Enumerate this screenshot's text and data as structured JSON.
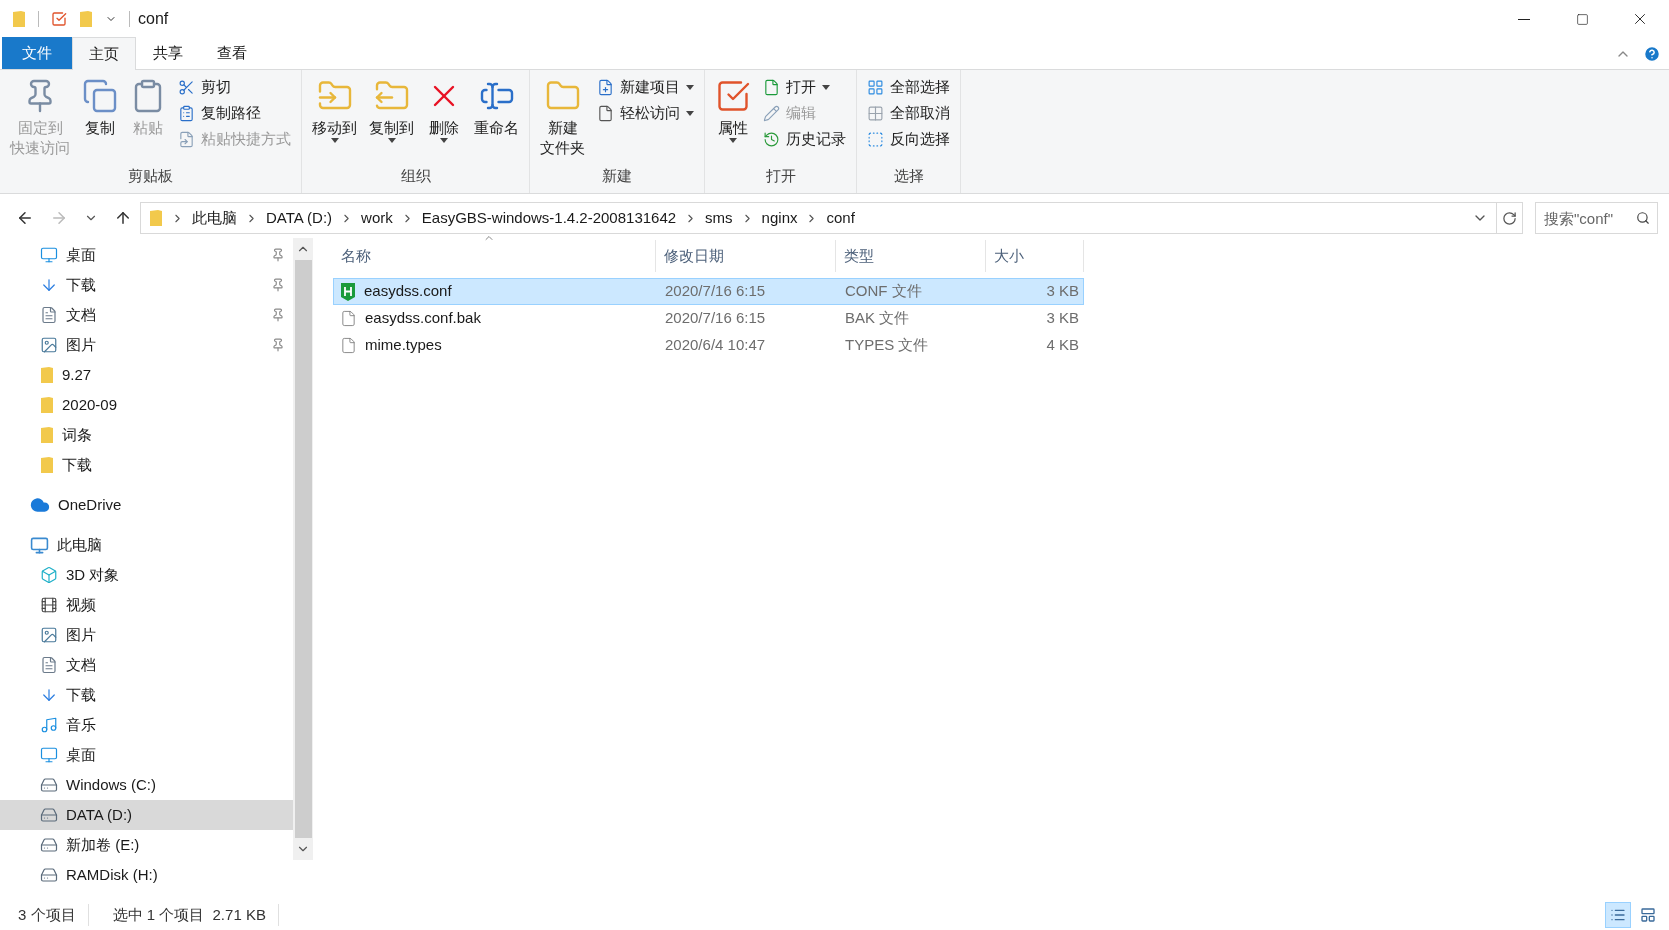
{
  "window": {
    "title": "conf"
  },
  "ribbon": {
    "tabs": [
      {
        "label": "文件",
        "kind": "file",
        "selected": false
      },
      {
        "label": "主页",
        "kind": "tab",
        "selected": true
      },
      {
        "label": "共享",
        "kind": "tab",
        "selected": false
      },
      {
        "label": "查看",
        "kind": "tab",
        "selected": false
      }
    ],
    "groups": [
      {
        "label": "剪贴板",
        "items": [
          {
            "lines": [
              "固定到",
              "快速访问"
            ],
            "kind": "large",
            "disabled": true,
            "caret": false
          },
          {
            "lines": [
              "复制"
            ],
            "kind": "large",
            "disabled": false,
            "caret": false
          },
          {
            "lines": [
              "粘贴"
            ],
            "kind": "large",
            "disabled": true,
            "caret": false
          },
          {
            "label": "剪切",
            "kind": "small",
            "disabled": false,
            "caret": false
          },
          {
            "label": "复制路径",
            "kind": "small",
            "disabled": false,
            "caret": false
          },
          {
            "label": "粘贴快捷方式",
            "kind": "small",
            "disabled": true,
            "caret": false
          }
        ]
      },
      {
        "label": "组织",
        "items": [
          {
            "lines": [
              "移动到"
            ],
            "kind": "large",
            "disabled": false,
            "caret": true
          },
          {
            "lines": [
              "复制到"
            ],
            "kind": "large",
            "disabled": false,
            "caret": true
          },
          {
            "lines": [
              "删除"
            ],
            "kind": "large",
            "disabled": false,
            "caret": true
          },
          {
            "lines": [
              "重命名"
            ],
            "kind": "large",
            "disabled": false,
            "caret": false
          }
        ]
      },
      {
        "label": "新建",
        "items": [
          {
            "lines": [
              "新建",
              "文件夹"
            ],
            "kind": "large",
            "disabled": false,
            "caret": false
          },
          {
            "label": "新建项目",
            "kind": "small",
            "disabled": false,
            "caret": true
          },
          {
            "label": "轻松访问",
            "kind": "small",
            "disabled": false,
            "caret": true
          }
        ]
      },
      {
        "label": "打开",
        "items": [
          {
            "lines": [
              "属性"
            ],
            "kind": "large",
            "disabled": false,
            "caret": true
          },
          {
            "label": "打开",
            "kind": "small",
            "disabled": false,
            "caret": true
          },
          {
            "label": "编辑",
            "kind": "small",
            "disabled": true,
            "caret": false
          },
          {
            "label": "历史记录",
            "kind": "small",
            "disabled": false,
            "caret": false
          }
        ]
      },
      {
        "label": "选择",
        "items": [
          {
            "label": "全部选择",
            "kind": "small",
            "disabled": false,
            "caret": false
          },
          {
            "label": "全部取消",
            "kind": "small",
            "disabled": false,
            "caret": false
          },
          {
            "label": "反向选择",
            "kind": "small",
            "disabled": false,
            "caret": false
          }
        ]
      }
    ]
  },
  "address": {
    "path": [
      "此电脑",
      "DATA (D:)",
      "work",
      "EasyGBS-windows-1.4.2-2008131642",
      "sms",
      "nginx",
      "conf"
    ],
    "search_placeholder": "搜索\"conf\""
  },
  "nav": {
    "quick_access": [
      {
        "label": "桌面",
        "pinned": true
      },
      {
        "label": "下载",
        "pinned": true
      },
      {
        "label": "文档",
        "pinned": true
      },
      {
        "label": "图片",
        "pinned": true
      },
      {
        "label": "9.27",
        "pinned": false
      },
      {
        "label": "2020-09",
        "pinned": false
      },
      {
        "label": "词条",
        "pinned": false
      },
      {
        "label": "下载",
        "pinned": false
      }
    ],
    "onedrive": {
      "label": "OneDrive"
    },
    "this_pc": {
      "label": "此电脑",
      "children": [
        {
          "label": "3D 对象",
          "selected": false
        },
        {
          "label": "视频",
          "selected": false
        },
        {
          "label": "图片",
          "selected": false
        },
        {
          "label": "文档",
          "selected": false
        },
        {
          "label": "下载",
          "selected": false
        },
        {
          "label": "音乐",
          "selected": false
        },
        {
          "label": "桌面",
          "selected": false
        },
        {
          "label": "Windows (C:)",
          "selected": false
        },
        {
          "label": "DATA (D:)",
          "selected": true
        },
        {
          "label": "新加卷 (E:)",
          "selected": false
        },
        {
          "label": "RAMDisk (H:)",
          "selected": false
        }
      ]
    }
  },
  "files": {
    "columns": [
      "名称",
      "修改日期",
      "类型",
      "大小"
    ],
    "rows": [
      {
        "name": "easydss.conf",
        "kind": "app-file",
        "date": "2020/7/16 6:15",
        "type": "CONF 文件",
        "size": "3 KB",
        "selected": true
      },
      {
        "name": "easydss.conf.bak",
        "kind": "plain-file",
        "date": "2020/7/16 6:15",
        "type": "BAK 文件",
        "size": "3 KB",
        "selected": false
      },
      {
        "name": "mime.types",
        "kind": "plain-file",
        "date": "2020/6/4 10:47",
        "type": "TYPES 文件",
        "size": "4 KB",
        "selected": false
      }
    ]
  },
  "status_bar": {
    "count": "3 个项目",
    "selection": "选中 1 个项目  2.71 KB",
    "views": [
      {
        "selected": true
      },
      {
        "selected": false
      }
    ]
  }
}
